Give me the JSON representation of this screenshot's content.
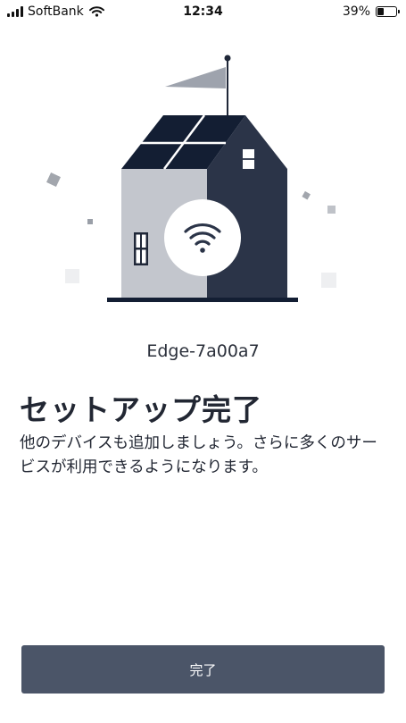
{
  "status_bar": {
    "carrier": "SoftBank",
    "time": "12:34",
    "battery_percent": "39%",
    "battery_level": 0.39
  },
  "device": {
    "name": "Edge-7a00a7"
  },
  "main": {
    "title": "セットアップ完了",
    "description": "他のデバイスも追加しましょう。さらに多くのサービスが利用できるようになります。"
  },
  "actions": {
    "done_label": "完了"
  },
  "colors": {
    "house_dark": "#2b3448",
    "house_light": "#c3c6cd",
    "roof": "#131e33",
    "flag": "#9ea3ad",
    "button": "#4b5568"
  },
  "icons": [
    "wifi-icon",
    "signal-icon",
    "battery-icon"
  ]
}
